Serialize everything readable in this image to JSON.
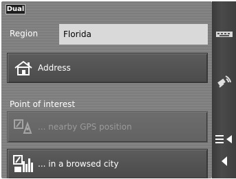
{
  "app": {
    "logo_text": "Dual"
  },
  "region": {
    "label": "Region",
    "value": "Florida"
  },
  "buttons": {
    "address": {
      "label": "Address",
      "icon": "house-icon"
    },
    "poi_heading": "Point of interest",
    "nearby_gps": {
      "label": "... nearby GPS position",
      "icon": "gps-poi-icon",
      "enabled": false
    },
    "browsed_city": {
      "label": "... in a browsed city",
      "icon": "city-poi-icon",
      "enabled": true
    }
  },
  "sidebar": {
    "keyboard_icon": "keyboard-icon",
    "satellite_icon": "satellite-icon",
    "menu_icon": "menu-icon",
    "back_icon": "back-arrow-icon"
  },
  "colors": {
    "background": "#7f7f7f",
    "button": "#505050",
    "input": "#d9d9d9",
    "sidebar": "#424242",
    "text": "#ffffff",
    "disabled_text": "#9b9b9b"
  }
}
